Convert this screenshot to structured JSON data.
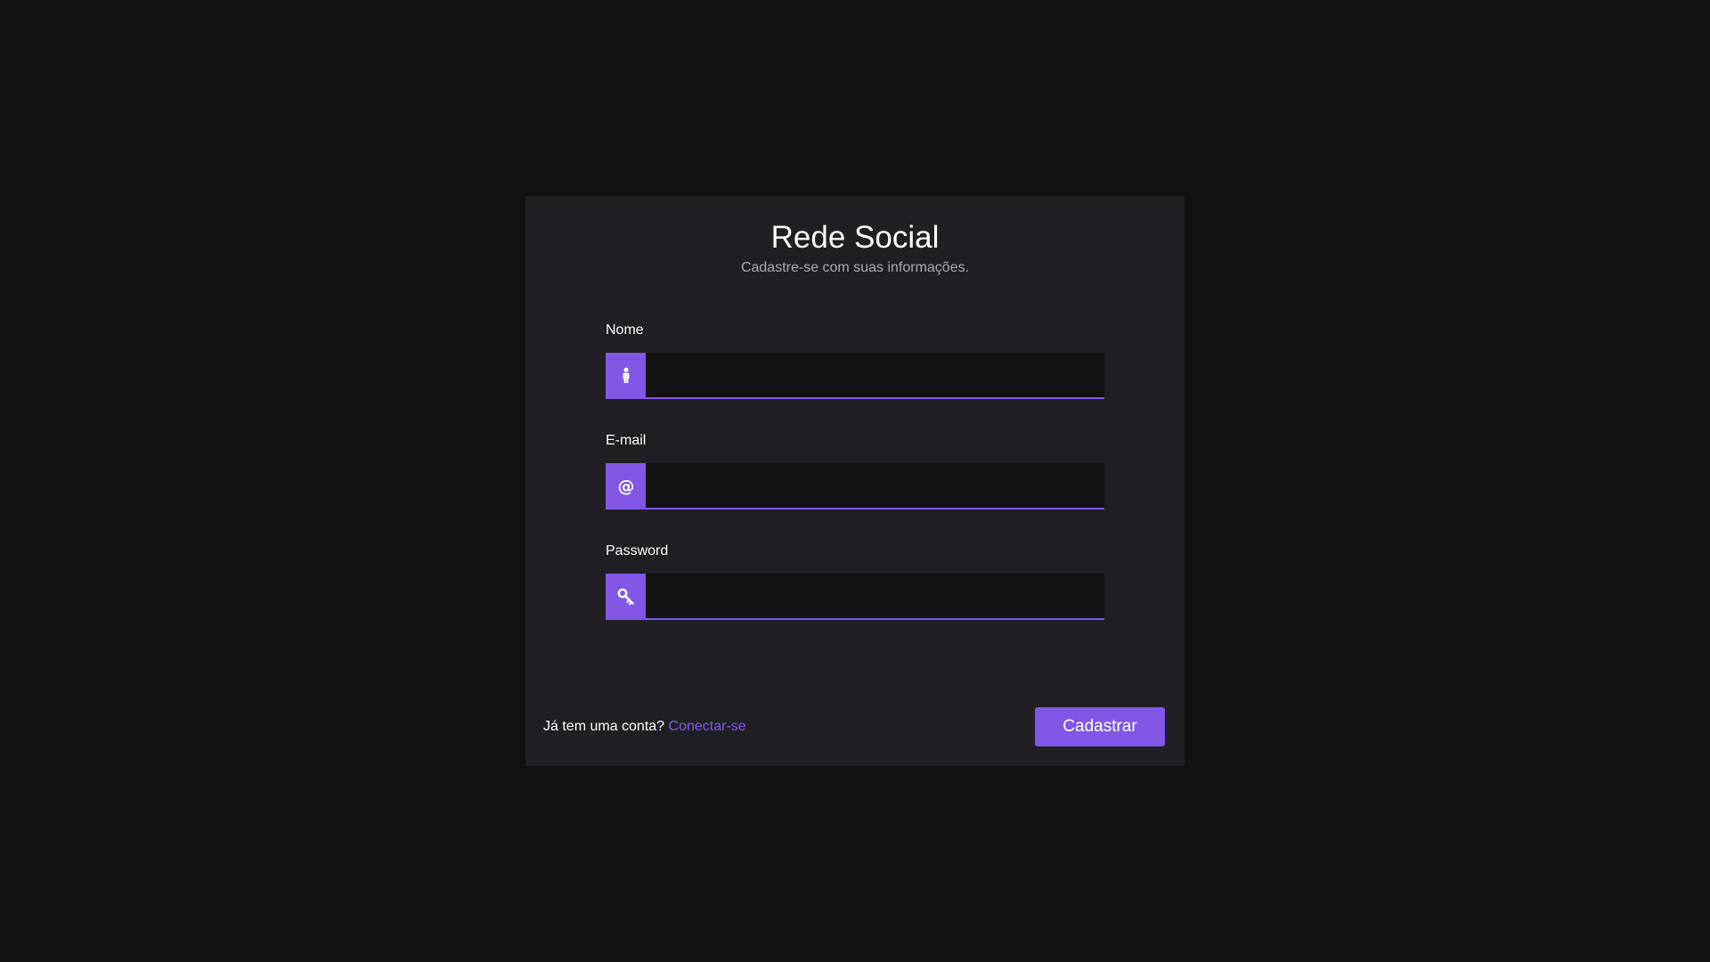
{
  "page": {
    "title": "Rede Social",
    "subtitle": "Cadastre-se com suas informações."
  },
  "form": {
    "fields": [
      {
        "label": "Nome",
        "icon": "person-icon",
        "value": "",
        "placeholder": ""
      },
      {
        "label": "E-mail",
        "icon": "at-sign-icon",
        "value": "",
        "placeholder": ""
      },
      {
        "label": "Password",
        "icon": "key-icon",
        "value": "",
        "placeholder": ""
      }
    ]
  },
  "footer": {
    "prompt": "Já tem uma conta?",
    "login_link": "Conectar-se",
    "submit_label": "Cadastrar"
  },
  "colors": {
    "background": "#121214",
    "card": "#202024",
    "accent": "#8257e5",
    "input_bg": "#121214",
    "text": "#ffffff",
    "muted_text": "#a8a8b3"
  }
}
